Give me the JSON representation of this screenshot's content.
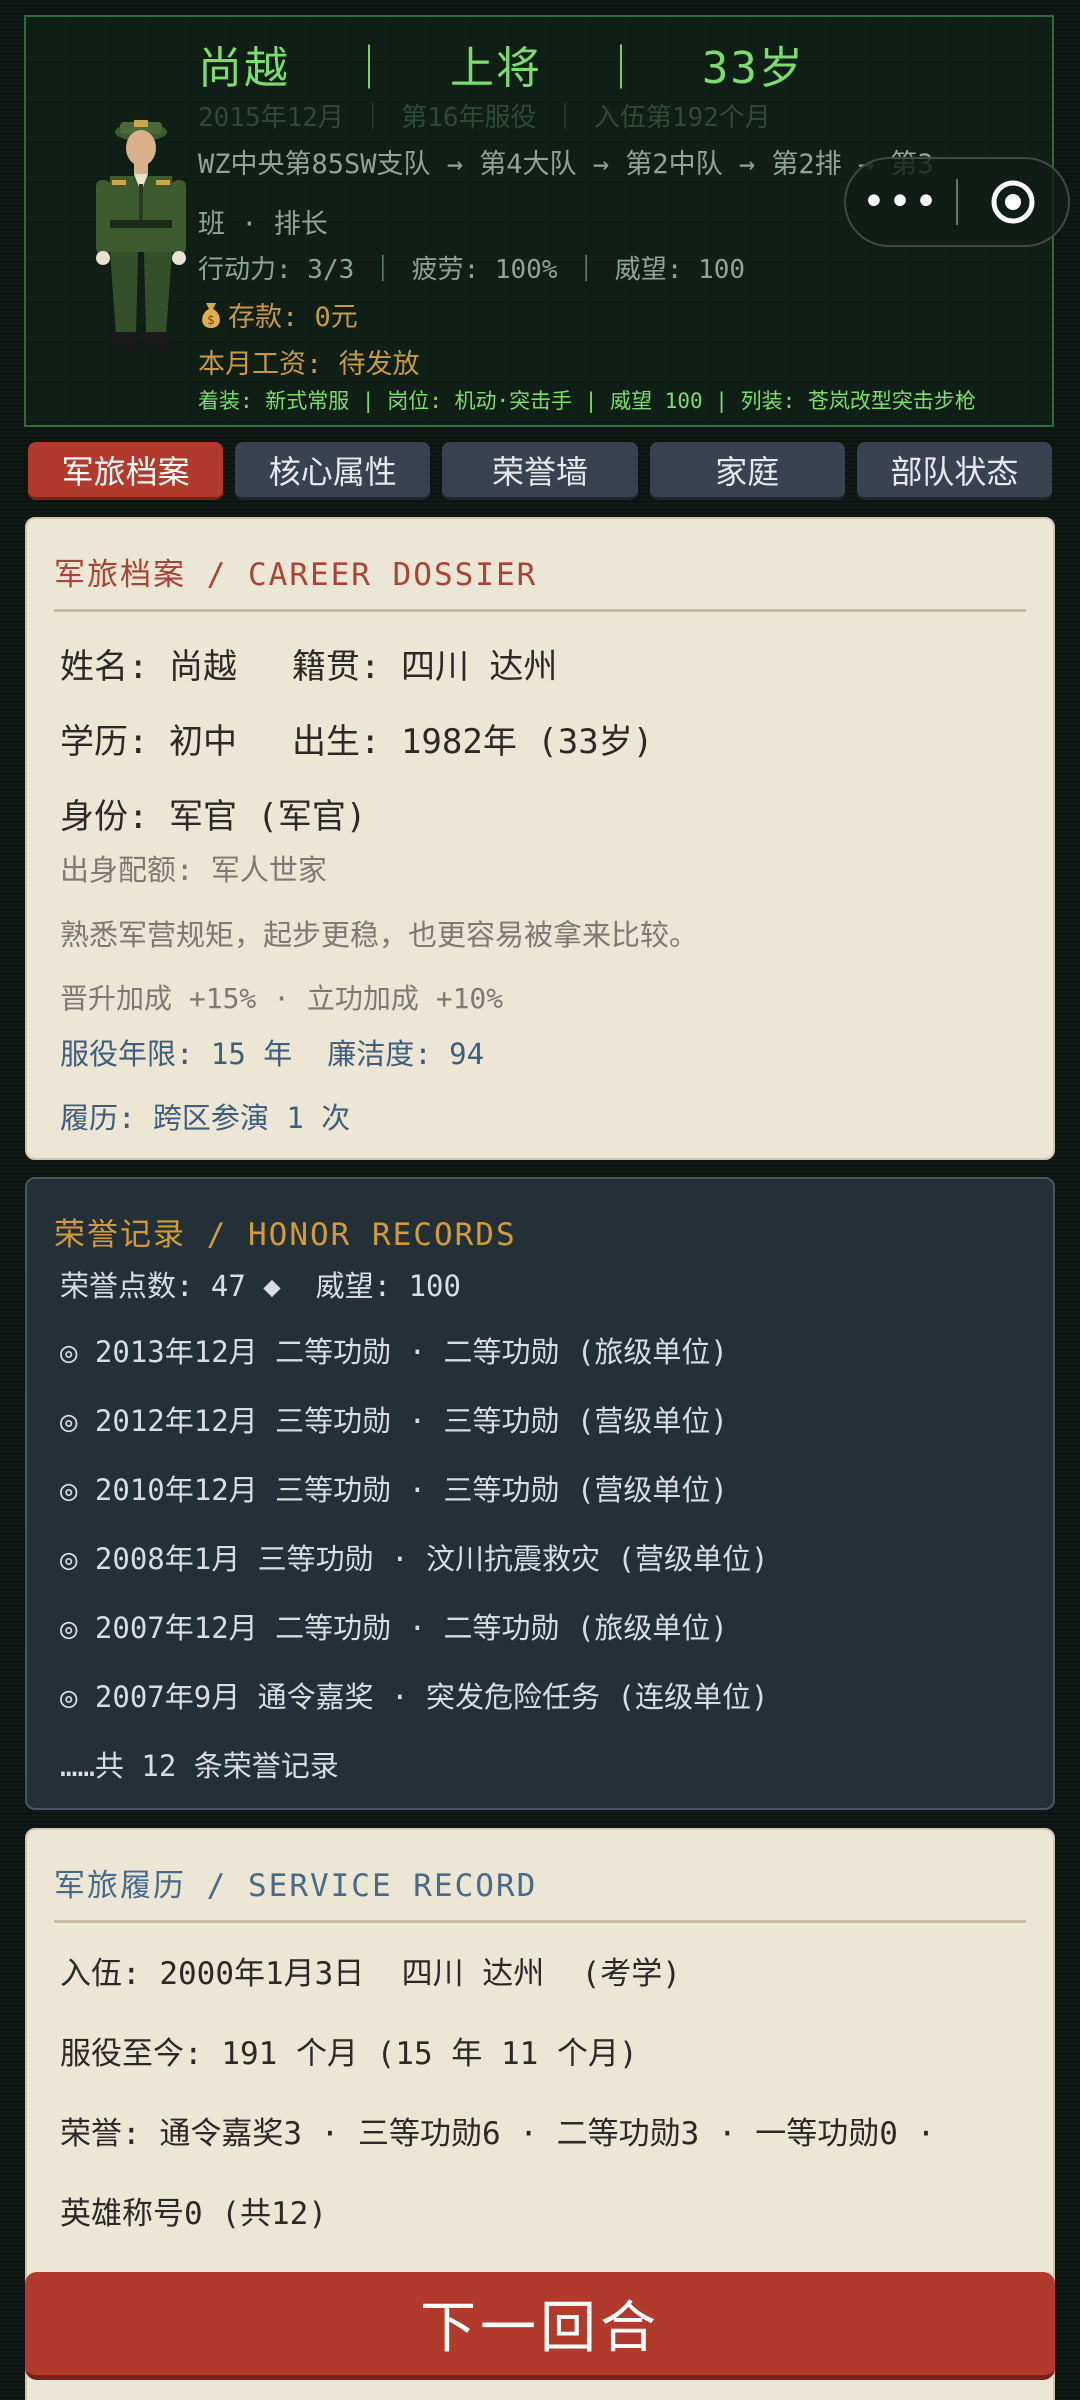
{
  "header": {
    "title": "尚越  ｜  上将  ｜  33岁",
    "subtitle": "2015年12月 ｜ 第16年服役 ｜ 入伍第192个月",
    "unit_line1": "WZ中央第85SW支队 → 第4大队 → 第2中队 → 第2排 → 第3",
    "unit_line2": "班 · 排长",
    "stats": "行动力: 3/3 ｜ 疲劳: 100% ｜ 威望: 100",
    "money_icon": "money-bag-icon",
    "money": "存款: 0元",
    "salary": "本月工资: 待发放",
    "equip": "着装: 新式常服 | 岗位: 机动·突击手 | 威望 100 | 列装: 苍岚改型突击步枪"
  },
  "capsule": {
    "more_icon": "more-dots-icon",
    "close_icon": "target-circle-icon"
  },
  "tabs": [
    {
      "label": "军旅档案",
      "active": true
    },
    {
      "label": "核心属性",
      "active": false
    },
    {
      "label": "荣誉墙",
      "active": false
    },
    {
      "label": "家庭",
      "active": false
    },
    {
      "label": "部队状态",
      "active": false
    }
  ],
  "dossier": {
    "title": "军旅档案 / CAREER DOSSIER",
    "name": "姓名: 尚越",
    "native": "籍贯: 四川 达州",
    "education": "学历: 初中",
    "birth": "出生: 1982年 (33岁)",
    "identity": "身份: 军官 (军官)",
    "origin": "出身配额: 军人世家",
    "desc": "熟悉军营规矩，起步更稳，也更容易被拿来比较。",
    "bonus": "晋升加成 +15% · 立功加成 +10%",
    "service_years": "服役年限: 15 年  廉洁度: 94",
    "history": "履历: 跨区参演 1 次"
  },
  "honor": {
    "title": "荣誉记录 / HONOR RECORDS",
    "points": "荣誉点数: 47 ◆  威望: 100",
    "records": [
      "◎ 2013年12月 二等功勋 · 二等功勋 (旅级单位)",
      "◎ 2012年12月 三等功勋 · 三等功勋 (营级单位)",
      "◎ 2010年12月 三等功勋 · 三等功勋 (营级单位)",
      "◎ 2008年1月 三等功勋 · 汶川抗震救灾 (营级单位)",
      "◎ 2007年12月 二等功勋 · 二等功勋 (旅级单位)",
      "◎ 2007年9月 通令嘉奖 · 突发危险任务 (连级单位)"
    ],
    "more": "……共 12 条荣誉记录"
  },
  "service": {
    "title": "军旅履历 / SERVICE RECORD",
    "enlist": "入伍: 2000年1月3日  四川 达州  (考学)",
    "duration": "服役至今: 191 个月 (15 年 11 个月)",
    "honors_line1": "荣誉: 通令嘉奖3 · 三等功勋6 · 二等功勋3 · 一等功勋0 ·",
    "honors_line2": "英雄称号0 (共12)"
  },
  "next_button": "下一回合",
  "colors": {
    "accent_red": "#b23a2c",
    "terminal_green": "#7ddc6f",
    "gold": "#c89a48",
    "dossier_title": "#a8453a",
    "honor_title": "#d39a3a",
    "service_title": "#4a6a88"
  }
}
